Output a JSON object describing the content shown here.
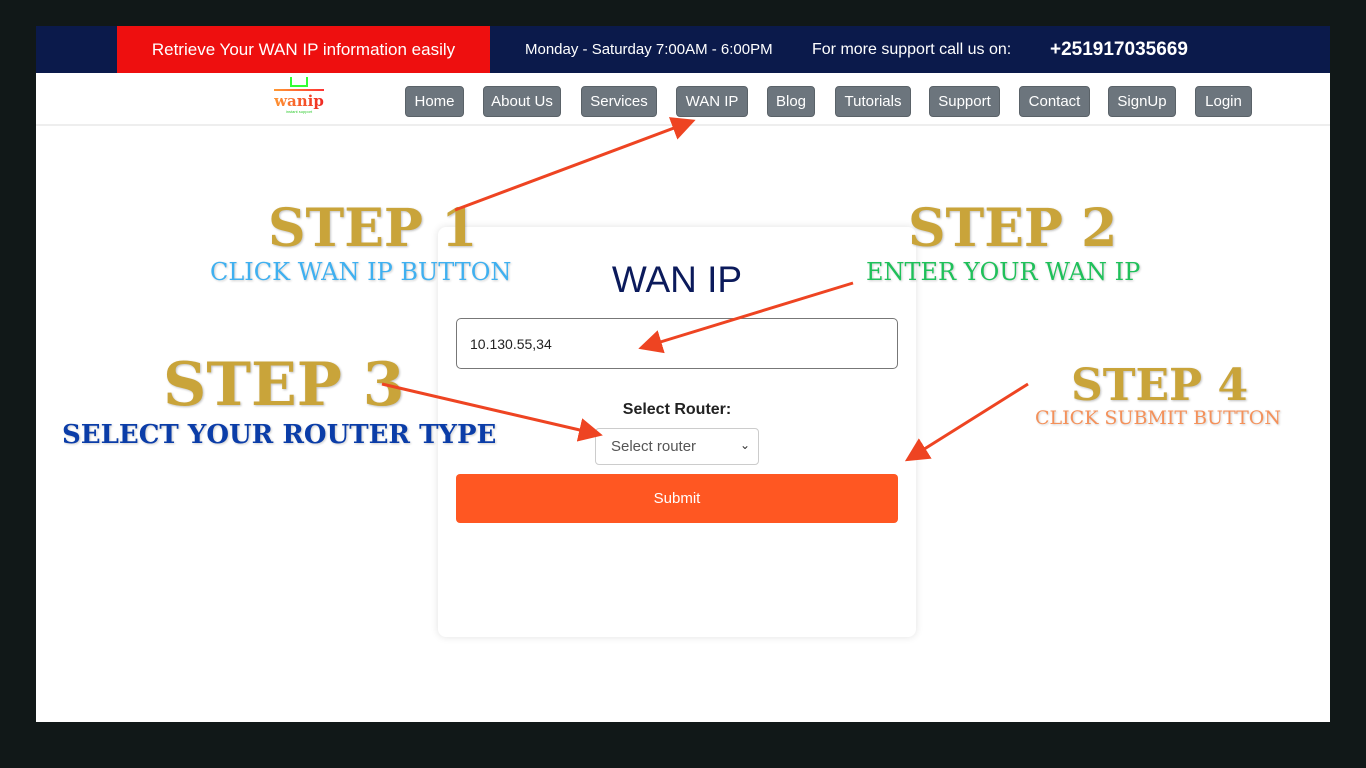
{
  "topbar": {
    "promo": "Retrieve Your WAN IP information easily",
    "hours": "Monday - Saturday 7:00AM - 6:00PM",
    "support_label": "For more support call us on:",
    "phone": "+251917035669"
  },
  "logo": {
    "name": "wanip",
    "tagline": "instant support"
  },
  "nav": [
    "Home",
    "About Us",
    "Services",
    "WAN IP",
    "Blog",
    "Tutorials",
    "Support",
    "Contact",
    "SignUp",
    "Login"
  ],
  "card": {
    "title": "WAN IP",
    "ip_value": "10.130.55,34",
    "select_label": "Select Router:",
    "select_value": "Select router",
    "submit": "Submit"
  },
  "steps": [
    {
      "title": "STEP 1",
      "desc": "CLICK WAN IP BUTTON"
    },
    {
      "title": "STEP 2",
      "desc": "ENTER YOUR WAN IP"
    },
    {
      "title": "STEP 3",
      "desc": "SELECT YOUR ROUTER TYPE"
    },
    {
      "title": "STEP 4",
      "desc": "CLICK SUBMIT BUTTON"
    }
  ],
  "colors": {
    "arrow": "#ee4422",
    "gold": "#c9a43a"
  }
}
